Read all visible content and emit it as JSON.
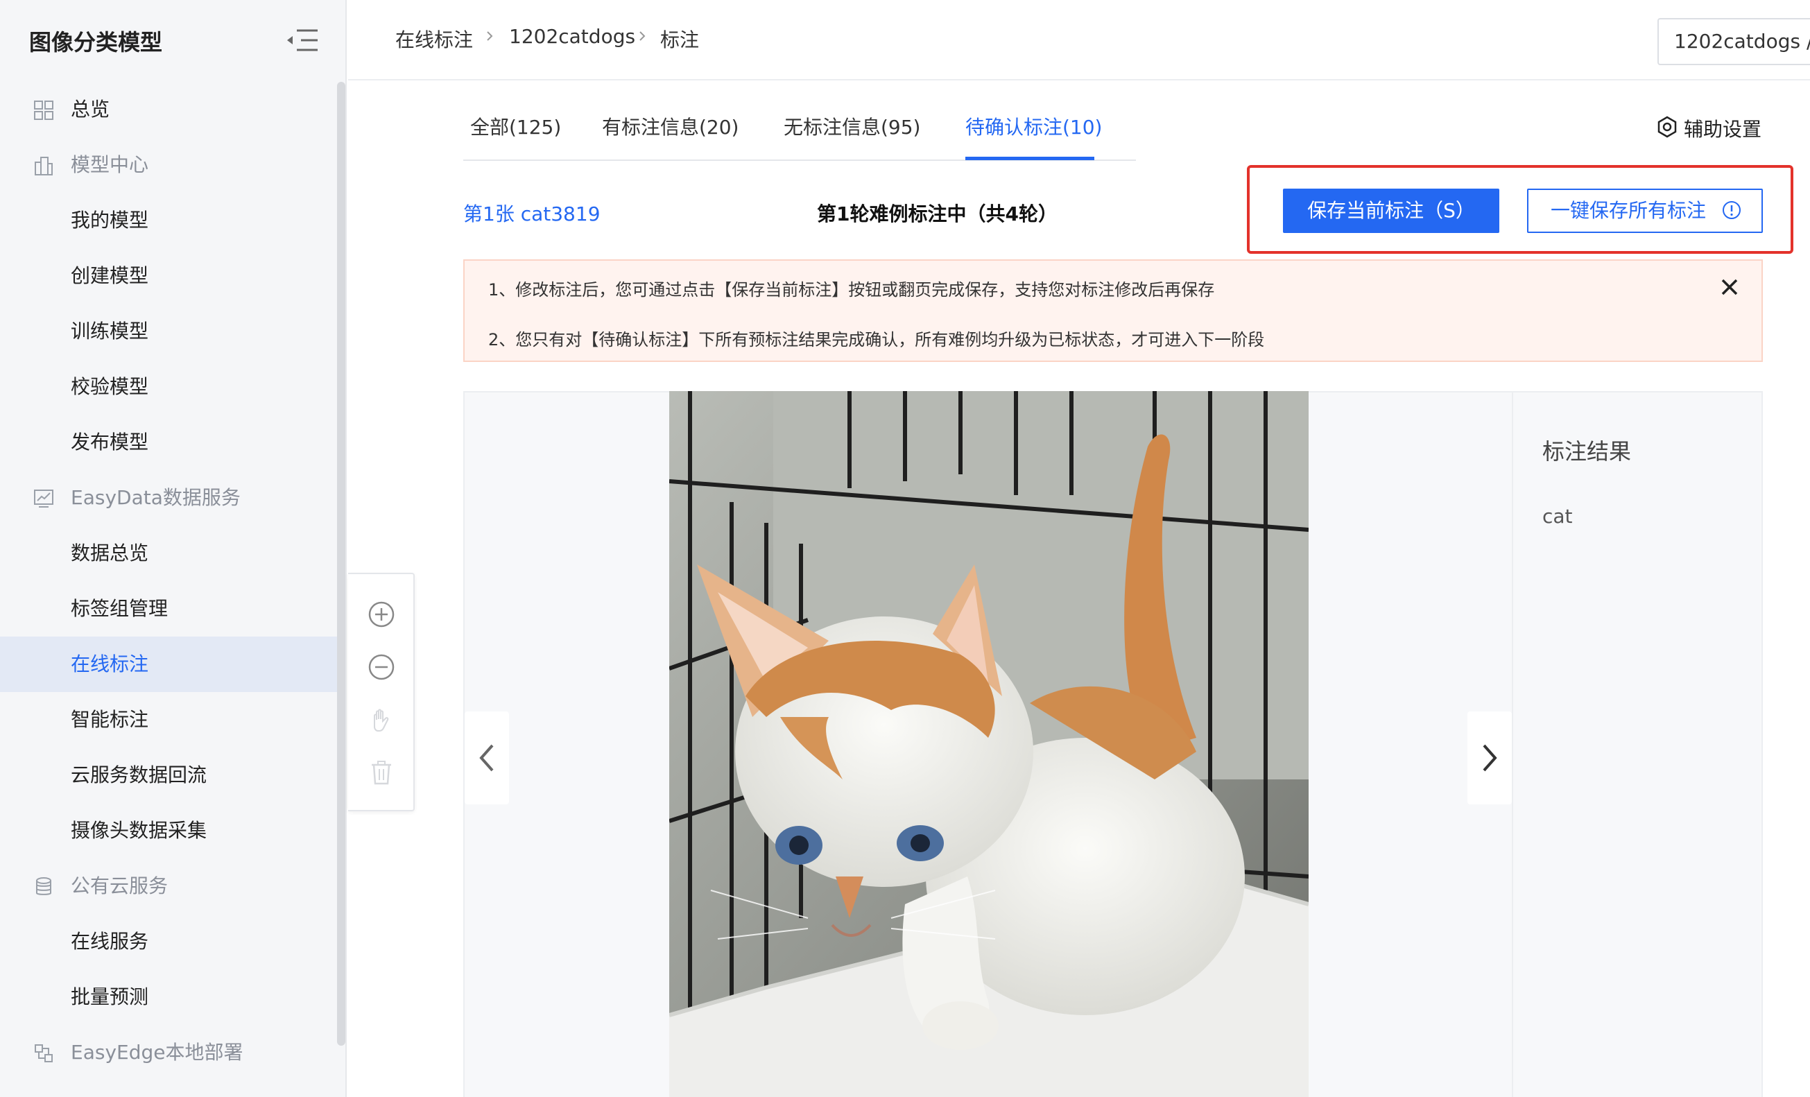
{
  "sidebar": {
    "title": "图像分类模型",
    "items": [
      {
        "label": "总览",
        "type": "group",
        "icon": "dashboard-grid-icon"
      },
      {
        "label": "模型中心",
        "type": "group",
        "icon": "building-icon"
      },
      {
        "label": "我的模型",
        "type": "child"
      },
      {
        "label": "创建模型",
        "type": "child"
      },
      {
        "label": "训练模型",
        "type": "child"
      },
      {
        "label": "校验模型",
        "type": "child"
      },
      {
        "label": "发布模型",
        "type": "child"
      },
      {
        "label": "EasyData数据服务",
        "type": "group",
        "icon": "chart-board-icon"
      },
      {
        "label": "数据总览",
        "type": "child"
      },
      {
        "label": "标签组管理",
        "type": "child"
      },
      {
        "label": "在线标注",
        "type": "child",
        "active": true
      },
      {
        "label": "智能标注",
        "type": "child"
      },
      {
        "label": "云服务数据回流",
        "type": "child"
      },
      {
        "label": "摄像头数据采集",
        "type": "child"
      },
      {
        "label": "公有云服务",
        "type": "group",
        "icon": "database-icon"
      },
      {
        "label": "在线服务",
        "type": "child"
      },
      {
        "label": "批量预测",
        "type": "child"
      },
      {
        "label": "EasyEdge本地部署",
        "type": "group",
        "icon": "edge-deploy-icon"
      }
    ]
  },
  "breadcrumb": [
    "在线标注",
    "1202catdogs",
    "标注"
  ],
  "project_selector": "1202catdogs /",
  "tabs": [
    {
      "label": "全部(125)"
    },
    {
      "label": "有标注信息(20)"
    },
    {
      "label": "无标注信息(95)"
    },
    {
      "label": "待确认标注(10)",
      "active": true
    }
  ],
  "assist_settings": "辅助设置",
  "image_index": "第1张 cat3819",
  "round_title": "第1轮难例标注中（共4轮）",
  "buttons": {
    "save_current": "保存当前标注（S）",
    "save_all": "一键保存所有标注"
  },
  "notice": {
    "line1": "1、修改标注后，您可通过点击【保存当前标注】按钮或翻页完成保存，支持您对标注修改后再保存",
    "line2": "2、您只有对【待确认标注】下所有预标注结果完成确认，所有难例均升级为已标状态，才可进入下一阶段"
  },
  "result": {
    "title": "标注结果",
    "value": "cat"
  },
  "colors": {
    "accent": "#2468f2",
    "highlight_frame": "#e3322b",
    "notice_bg": "#fff3ef"
  }
}
